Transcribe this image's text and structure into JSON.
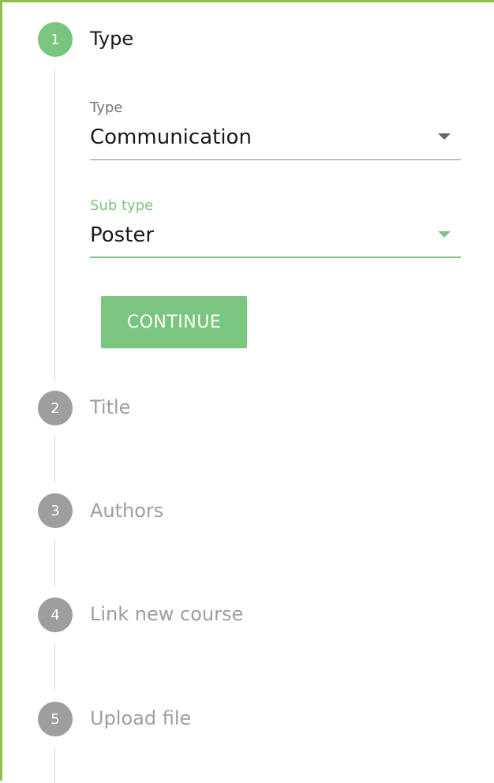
{
  "steps": [
    {
      "number": "1",
      "title": "Type",
      "state": "active"
    },
    {
      "number": "2",
      "title": "Title",
      "state": "inactive"
    },
    {
      "number": "3",
      "title": "Authors",
      "state": "inactive"
    },
    {
      "number": "4",
      "title": "Link new course",
      "state": "inactive"
    },
    {
      "number": "5",
      "title": "Upload file",
      "state": "inactive"
    }
  ],
  "form": {
    "type_field": {
      "label": "Type",
      "value": "Communication"
    },
    "subtype_field": {
      "label": "Sub type",
      "value": "Poster"
    },
    "continue_label": "CONTINUE"
  },
  "colors": {
    "accent": "#7bc67e",
    "frame_border": "#8bc34a",
    "inactive": "#9e9e9e"
  }
}
